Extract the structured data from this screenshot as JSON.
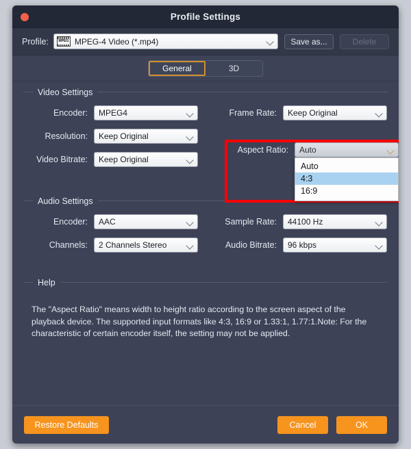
{
  "window": {
    "title": "Profile Settings",
    "close_icon": "close-icon"
  },
  "profile": {
    "label": "Profile:",
    "icon_text": "MPEG",
    "value": "MPEG-4 Video (*.mp4)",
    "save_as_label": "Save as...",
    "delete_label": "Delete"
  },
  "tabs": [
    {
      "label": "General",
      "active": true
    },
    {
      "label": "3D",
      "active": false
    }
  ],
  "video_settings": {
    "title": "Video Settings",
    "fields": [
      {
        "label": "Encoder:",
        "value": "MPEG4"
      },
      {
        "label": "Resolution:",
        "value": "Keep Original"
      },
      {
        "label": "Video Bitrate:",
        "value": "Keep Original"
      }
    ],
    "frame_rate": {
      "label": "Frame Rate:",
      "value": "Keep Original"
    },
    "aspect_ratio": {
      "label": "Aspect Ratio:",
      "value": "Auto",
      "expanded": true,
      "options": [
        "Auto",
        "4:3",
        "16:9"
      ],
      "selected_option": "4:3",
      "highlight_color": "#ff0000"
    }
  },
  "audio_settings": {
    "title": "Audio Settings",
    "fields": [
      {
        "label": "Encoder:",
        "value": "AAC"
      },
      {
        "label": "Channels:",
        "value": "2 Channels Stereo"
      }
    ],
    "right_fields": [
      {
        "label": "Sample Rate:",
        "value": "44100 Hz"
      },
      {
        "label": "Audio Bitrate:",
        "value": "96 kbps"
      }
    ]
  },
  "help": {
    "title": "Help",
    "body": "The \"Aspect Ratio\" means width to height ratio according to the screen aspect of the playback device. The supported input formats like 4:3, 16:9 or 1.33:1, 1.77:1.Note: For the characteristic of certain encoder itself, the setting may not be applied."
  },
  "footer": {
    "restore_label": "Restore Defaults",
    "cancel_label": "Cancel",
    "ok_label": "OK",
    "accent_color": "#f7941e"
  }
}
